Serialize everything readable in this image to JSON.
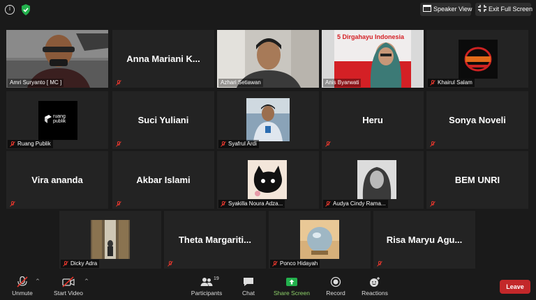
{
  "topbar": {
    "speaker_view": "Speaker View",
    "exit_full_screen": "Exit Full Screen"
  },
  "participants": [
    {
      "name": "Amri Suryanto [ MC ]",
      "mode": "video",
      "active": true
    },
    {
      "name": "Anna Mariani K...",
      "mode": "name"
    },
    {
      "name": "Azhari Setiawan",
      "mode": "video"
    },
    {
      "name": "Anis Byarwati",
      "mode": "video",
      "overlay": "5  Dirgahayu Indonesia"
    },
    {
      "name": "Khairul Salam",
      "mode": "avatar"
    },
    {
      "name": "Ruang Publik",
      "mode": "avatar",
      "logo_text": "ruang publik"
    },
    {
      "name": "Suci Yuliani",
      "mode": "name"
    },
    {
      "name": "Syafrul Ardi",
      "mode": "avatar"
    },
    {
      "name": "Heru",
      "mode": "name"
    },
    {
      "name": "Sonya Noveli",
      "mode": "name"
    },
    {
      "name": "Vira ananda",
      "mode": "name"
    },
    {
      "name": "Akbar Islami",
      "mode": "name"
    },
    {
      "name": "Syakilla Noura Adza...",
      "mode": "avatar"
    },
    {
      "name": "Audya Cindy Rama...",
      "mode": "avatar"
    },
    {
      "name": "BEM UNRI",
      "mode": "name"
    },
    {
      "name": "Dicky Adra",
      "mode": "avatar"
    },
    {
      "name": "Theta  Margariti...",
      "mode": "name"
    },
    {
      "name": "Ponco Hidayah",
      "mode": "avatar"
    },
    {
      "name": "Risa Maryu  Agu...",
      "mode": "name"
    }
  ],
  "toolbar": {
    "unmute": "Unmute",
    "start_video": "Start Video",
    "participants": "Participants",
    "participants_count": "19",
    "chat": "Chat",
    "share_screen": "Share Screen",
    "record": "Record",
    "reactions": "Reactions",
    "leave": "Leave"
  },
  "colors": {
    "active_speaker": "#c8e46c",
    "share_green": "#8fd36a",
    "leave_red": "#c3282a",
    "muted_red": "#e0362c"
  }
}
